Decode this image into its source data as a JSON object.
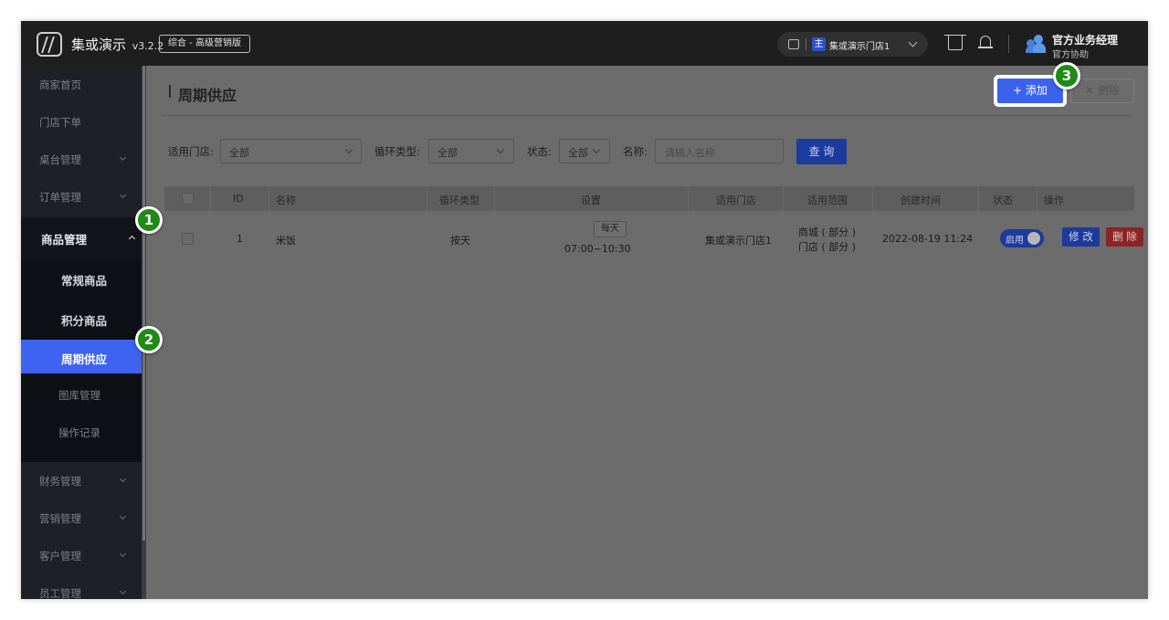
{
  "header": {
    "app_name": "集或演示",
    "version": "v3.2.2",
    "edition": "综合 - 高级营销版",
    "store_badge": "主",
    "store_name": "集或演示门店1",
    "user_name": "官方业务经理",
    "user_role": "官方协助"
  },
  "sidebar": {
    "items": [
      {
        "label": "商家首页"
      },
      {
        "label": "门店下单"
      },
      {
        "label": "桌台管理"
      },
      {
        "label": "订单管理"
      }
    ],
    "group": {
      "label": "商品管理"
    },
    "subitems": [
      {
        "label": "常规商品"
      },
      {
        "label": "积分商品"
      },
      {
        "label": "周期供应"
      },
      {
        "label": "图库管理"
      },
      {
        "label": "操作记录"
      }
    ],
    "items_after": [
      {
        "label": "财务管理"
      },
      {
        "label": "营销管理"
      },
      {
        "label": "客户管理"
      },
      {
        "label": "员工管理"
      }
    ]
  },
  "page": {
    "title": "周期供应",
    "add_label": "添加",
    "delete_label": "删除"
  },
  "filters": {
    "store_label": "适用门店:",
    "store_value": "全部",
    "cycle_label": "循环类型:",
    "cycle_value": "全部",
    "status_label": "状态:",
    "status_value": "全部",
    "name_label": "名称:",
    "name_placeholder": "请输入名称",
    "query_label": "查 询"
  },
  "table": {
    "columns": [
      "ID",
      "名称",
      "循环类型",
      "设置",
      "适用门店",
      "适用范围",
      "创建时间",
      "状态",
      "操作"
    ],
    "rows": [
      {
        "id": "1",
        "name": "米饭",
        "cycle": "按天",
        "setting_tag": "每天",
        "setting_time": "07:00~10:30",
        "store": "集或演示门店1",
        "scope_line1": "商城 ( 部分 )",
        "scope_line2": "门店 ( 部分 )",
        "created": "2022-08-19 11:24",
        "status_label": "启用",
        "edit_label": "修 改",
        "remove_label": "删 除"
      }
    ]
  },
  "steps": [
    "1",
    "2",
    "3"
  ],
  "colors": {
    "accent": "#3a62ee",
    "step_badge": "#1f8a14",
    "danger": "#8c2424"
  }
}
